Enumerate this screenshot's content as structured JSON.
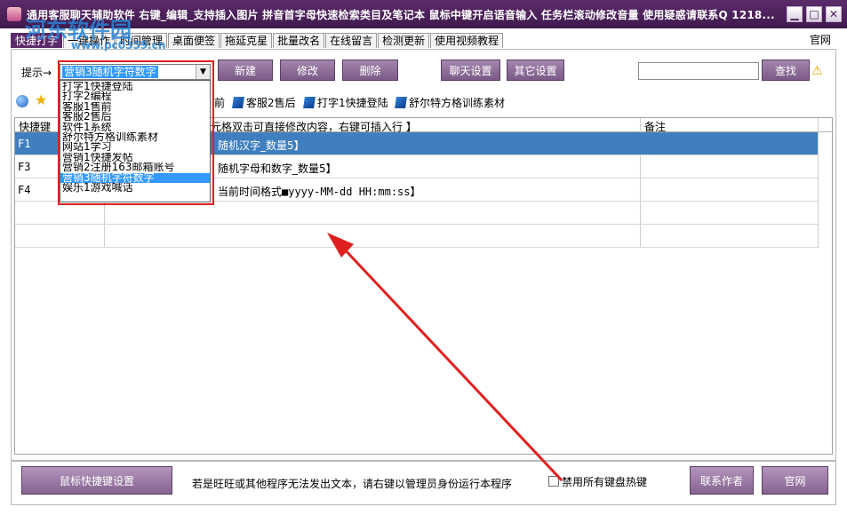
{
  "window": {
    "title": "通用客服聊天辅助软件   右键_编辑_支持插入图片   拼音首字母快速检索类目及笔记本   鼠标中键开启语音输入   任务栏滚动修改音量   使用疑惑请联系Q  1218...",
    "minimize": "▁",
    "maximize": "□",
    "close": "✕"
  },
  "watermark": {
    "text": "河东软件园",
    "url": "www.pc0359.cn"
  },
  "tabs": [
    "快捷打字",
    "一键操作",
    "时间管理",
    "桌面便签",
    "拖延克星",
    "批量改名",
    "在线留言",
    "检测更新",
    "使用视频教程"
  ],
  "tab_right": "官网",
  "toolbar": {
    "hint_label": "提示→",
    "category_selected": "营销3随机字符数字",
    "new_label": "新建",
    "edit_label": "修改",
    "delete_label": "删除",
    "chat_settings_label": "聊天设置",
    "other_settings_label": "其它设置",
    "search_label": "查找"
  },
  "dropdown": {
    "options": [
      "打字1快捷登陆",
      "打字2编程",
      "客服1售前",
      "客服2售后",
      "软件1系统",
      "舒尔特方格训练素材",
      "网站1学习",
      "营销1快捷发帖",
      "营销2注册163邮箱账号",
      "营销3随机字符数字",
      "娱乐1游戏喊话"
    ],
    "selected_index": 9
  },
  "quickbar": {
    "item1": "前",
    "item2": "客服2售后",
    "item3": "打字1快捷登陆",
    "item4": "舒尔特方格训练素材"
  },
  "grid": {
    "headers": {
      "key": "快捷键（",
      "content": "元格双击可直接修改内容，右键可插入行 】",
      "note": "备注"
    },
    "rows": [
      {
        "key": "F1",
        "content": "随机汉字_数量5】",
        "note": ""
      },
      {
        "key": "F3",
        "content": "随机字母和数字_数量5】",
        "note": ""
      },
      {
        "key": "F4",
        "content": "当前时间格式■yyyy-MM-dd HH:mm:ss】",
        "note": ""
      }
    ]
  },
  "bottom": {
    "mouse_shortcut_label": "鼠标快捷键设置",
    "notice": "若是旺旺或其他程序无法发出文本，请右键以管理员身份运行本程序",
    "disable_hotkeys_label": "禁用所有键盘热键",
    "contact_author_label": "联系作者",
    "website_label": "官网"
  },
  "colors": {
    "title_bg": "#4a2058",
    "button_bg": "#8d6c99",
    "selected_row": "#3f7fc0",
    "annotation_red": "#e02020"
  }
}
